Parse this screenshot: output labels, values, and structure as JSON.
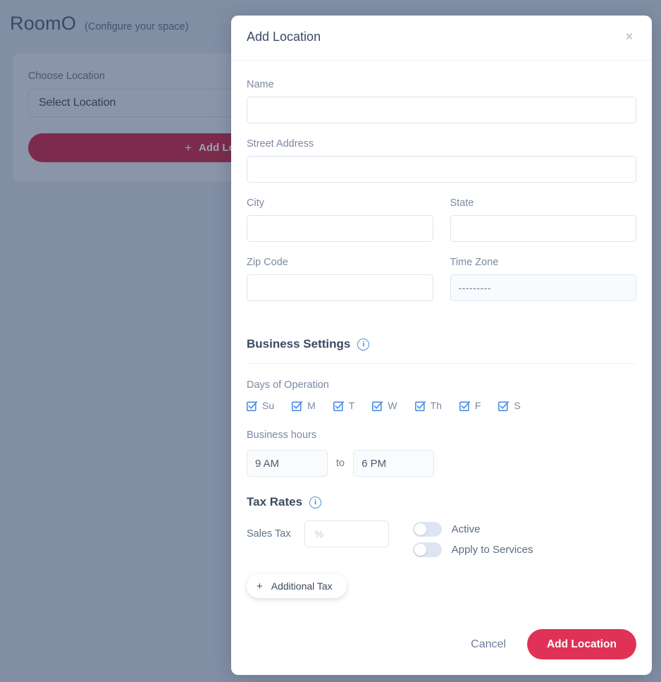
{
  "background": {
    "app_title": "RoomO",
    "app_subtitle": "(Configure your space)",
    "card": {
      "choose_location_label": "Choose Location",
      "select_value": "Select Location",
      "add_location_button": "Add Location",
      "plus": "+"
    }
  },
  "modal": {
    "title": "Add Location",
    "close_icon": "×",
    "fields": {
      "name_label": "Name",
      "name_value": "",
      "street_label": "Street Address",
      "street_value": "",
      "city_label": "City",
      "city_value": "",
      "state_label": "State",
      "state_value": "",
      "zip_label": "Zip Code",
      "zip_value": "",
      "timezone_label": "Time Zone",
      "timezone_value": "---------"
    },
    "business_settings": {
      "title": "Business Settings",
      "info_icon": "i",
      "days_label": "Days of Operation",
      "days": [
        {
          "label": "Su",
          "checked": true
        },
        {
          "label": "M",
          "checked": true
        },
        {
          "label": "T",
          "checked": true
        },
        {
          "label": "W",
          "checked": true
        },
        {
          "label": "Th",
          "checked": true
        },
        {
          "label": "F",
          "checked": true
        },
        {
          "label": "S",
          "checked": true
        }
      ],
      "hours_label": "Business hours",
      "open_time": "9 AM",
      "to_label": "to",
      "close_time": "6 PM"
    },
    "tax_rates": {
      "title": "Tax Rates",
      "info_icon": "i",
      "sales_tax_label": "Sales Tax",
      "sales_tax_value": "",
      "sales_tax_placeholder": "%",
      "toggles": [
        {
          "label": "Active",
          "on": false
        },
        {
          "label": "Apply to Services",
          "on": false
        }
      ],
      "additional_tax_button": "Additional Tax",
      "additional_tax_plus": "+"
    },
    "footer": {
      "cancel_label": "Cancel",
      "submit_label": "Add Location"
    }
  },
  "colors": {
    "overlay": "#828ea4",
    "primary": "#e03257",
    "primary_dimmed": "#7d2b4d",
    "accent_blue": "#4a90e2",
    "text_dark": "#3c4a63",
    "text_muted": "#7b89a3"
  }
}
